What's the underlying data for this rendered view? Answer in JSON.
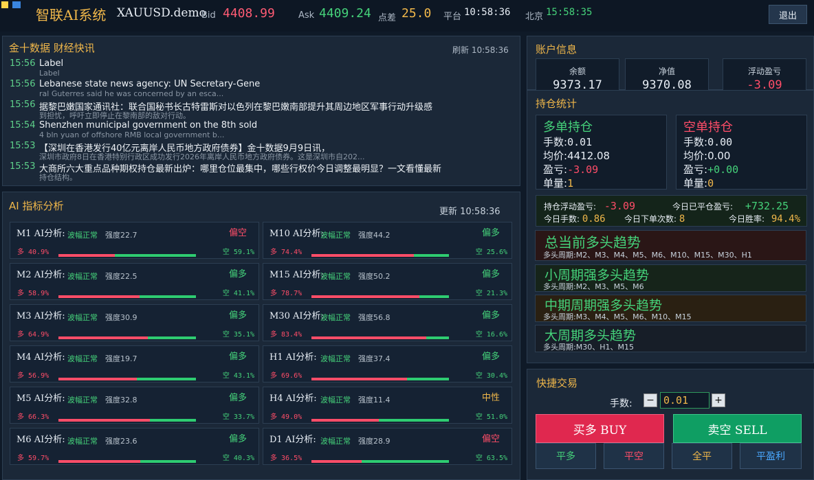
{
  "colors": {
    "gold": "#f0b74a",
    "buy": "#e0284f",
    "sell": "#0f9e63",
    "up": "#45d27a",
    "down": "#ff4d68"
  },
  "header": {
    "app_title": "智联AI系统",
    "symbol": "XAUUSD.demo",
    "bid_label": "Bid",
    "bid": "4408.99",
    "ask_label": "Ask",
    "ask": "4409.24",
    "spread_label": "点差",
    "spread": "25.0",
    "platform_label": "平台",
    "platform_time": "10:58:36",
    "beijing_label": "北京",
    "beijing_time": "15:58:35",
    "exit_label": "退出"
  },
  "news": {
    "title": "金十数据 财经快讯",
    "refresh": "刷新 10:58:36",
    "items": [
      {
        "time": "15:56",
        "title": "Label",
        "sub": "Label"
      },
      {
        "time": "15:56",
        "title": "Lebanese state news agency: UN Secretary-Gene",
        "sub": "ral Guterres said he was concerned by an esca..."
      },
      {
        "time": "15:56",
        "title": "据黎巴嫩国家通讯社：联合国秘书长古特雷斯对以色列在黎巴嫩南部提升其周边地区军事行动升级感",
        "sub": "到担忧，呼吁立即停止在黎南部的敌对行动。"
      },
      {
        "time": "15:54",
        "title": "Shenzhen municipal government on the 8th sold",
        "sub": "4 bln yuan of offshore RMB local government b..."
      },
      {
        "time": "15:53",
        "title": "【深圳在香港发行40亿元离岸人民币地方政府债券】金十数据9月9日讯，",
        "sub": "深圳市政府8日在香港特别行政区成功发行2026年离岸人民币地方政府债券。这是深圳市自202..."
      },
      {
        "time": "15:53",
        "title": "大商所六大重点品种期权持仓最新出炉：哪里仓位最集中，哪些行权价今日调整最明显？一文看懂最新",
        "sub": "持仓结构。"
      }
    ]
  },
  "ai": {
    "title": "AI 指标分析",
    "updated": "更新 10:58:36",
    "cards": [
      {
        "name": "M1 AI分析:",
        "wave": "波幅正常",
        "strength": "强度22.7",
        "signal": "偏空",
        "long": "多 40.9%",
        "short": "空 59.1%",
        "long_pct": 40.9
      },
      {
        "name": "M10 AI分析:",
        "wave": "波幅正常",
        "strength": "强度44.2",
        "signal": "偏多",
        "long": "多 74.4%",
        "short": "空 25.6%",
        "long_pct": 74.4
      },
      {
        "name": "M2 AI分析:",
        "wave": "波幅正常",
        "strength": "强度22.5",
        "signal": "偏多",
        "long": "多 58.9%",
        "short": "空 41.1%",
        "long_pct": 58.9
      },
      {
        "name": "M15 AI分析:",
        "wave": "波幅正常",
        "strength": "强度50.2",
        "signal": "偏多",
        "long": "多 78.7%",
        "short": "空 21.3%",
        "long_pct": 78.7
      },
      {
        "name": "M3 AI分析:",
        "wave": "波幅正常",
        "strength": "强度30.9",
        "signal": "偏多",
        "long": "多 64.9%",
        "short": "空 35.1%",
        "long_pct": 64.9
      },
      {
        "name": "M30 AI分析:",
        "wave": "波幅正常",
        "strength": "强度56.8",
        "signal": "偏多",
        "long": "多 83.4%",
        "short": "空 16.6%",
        "long_pct": 83.4
      },
      {
        "name": "M4 AI分析:",
        "wave": "波幅正常",
        "strength": "强度19.7",
        "signal": "偏多",
        "long": "多 56.9%",
        "short": "空 43.1%",
        "long_pct": 56.9
      },
      {
        "name": "H1 AI分析:",
        "wave": "波幅正常",
        "strength": "强度37.4",
        "signal": "偏多",
        "long": "多 69.6%",
        "short": "空 30.4%",
        "long_pct": 69.6
      },
      {
        "name": "M5 AI分析:",
        "wave": "波幅正常",
        "strength": "强度32.8",
        "signal": "偏多",
        "long": "多 66.3%",
        "short": "空 33.7%",
        "long_pct": 66.3
      },
      {
        "name": "H4 AI分析:",
        "wave": "波幅正常",
        "strength": "强度11.4",
        "signal": "中性",
        "long": "多 49.0%",
        "short": "空 51.0%",
        "long_pct": 49.0
      },
      {
        "name": "M6 AI分析:",
        "wave": "波幅正常",
        "strength": "强度23.6",
        "signal": "偏多",
        "long": "多 59.7%",
        "short": "空 40.3%",
        "long_pct": 59.7
      },
      {
        "name": "D1 AI分析:",
        "wave": "波幅正常",
        "strength": "强度28.9",
        "signal": "偏空",
        "long": "多 36.5%",
        "short": "空 63.5%",
        "long_pct": 36.5
      }
    ]
  },
  "account": {
    "title": "账户信息",
    "balance_label": "余额",
    "balance": "9373.17",
    "equity_label": "净值",
    "equity": "9370.08",
    "float_label": "浮动盈亏",
    "float": "-3.09"
  },
  "positions": {
    "title": "持仓统计",
    "long": {
      "title": "多单持仓",
      "lots_label": "手数:",
      "lots": "0.01",
      "avg_label": "均价:",
      "avg": "4412.08",
      "pnl_label": "盈亏:",
      "pnl": "-3.09",
      "count_label": "单量:",
      "count": "1"
    },
    "short": {
      "title": "空单持仓",
      "lots_label": "手数:",
      "lots": "0.00",
      "avg_label": "均价:",
      "avg": "0.00",
      "pnl_label": "盈亏:",
      "pnl": "+0.00",
      "count_label": "单量:",
      "count": "0"
    },
    "float_pnl_label": "持仓浮动盈亏:",
    "float_pnl": "-3.09",
    "closed_pnl_label": "今日已平仓盈亏:",
    "closed_pnl": "+732.25",
    "today_lots_label": "今日手数:",
    "today_lots": "0.86",
    "today_orders_label": "今日下单次数:",
    "today_orders": "8",
    "win_rate_label": "今日胜率:",
    "win_rate": "94.4%"
  },
  "trends": [
    {
      "title": "总当前多头趋势",
      "sub": "多头周期:M2、M3、M4、M5、M6、M10、M15、M30、H1"
    },
    {
      "title": "小周期强多头趋势",
      "sub": "多头周期:M2、M3、M5、M6"
    },
    {
      "title": "中期周期强多头趋势",
      "sub": "多头周期:M3、M4、M5、M6、M10、M15"
    },
    {
      "title": "大周期多头趋势",
      "sub": "多头周期:M30、H1、M15"
    }
  ],
  "trade": {
    "title": "快捷交易",
    "lots_label": "手数:",
    "lots_value": "0.01",
    "minus": "−",
    "plus": "+",
    "buy": "买多 BUY",
    "sell": "卖空 SELL",
    "close_long": "平多",
    "close_short": "平空",
    "close_all": "全平",
    "close_profit": "平盈利"
  }
}
